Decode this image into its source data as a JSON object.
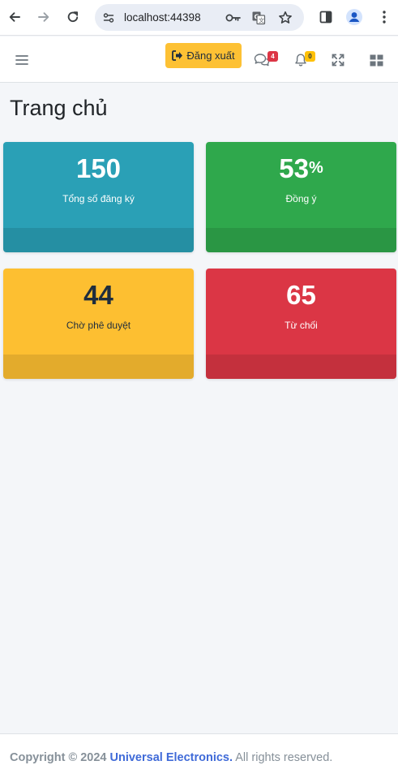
{
  "browser": {
    "url": "localhost:44398",
    "icons": [
      "back-arrow-icon",
      "forward-arrow-icon",
      "reload-icon",
      "site-settings-icon",
      "password-key-icon",
      "translate-icon",
      "bookmark-star-icon",
      "side-panel-icon",
      "profile-avatar-icon",
      "more-menu-icon"
    ]
  },
  "navbar": {
    "logout_label": "Đăng xuất",
    "messages_count": "4",
    "notifications_count": "0",
    "colors": {
      "logout_bg": "#fdc134",
      "messages_badge": "#dc3545",
      "notifications_badge": "#ffc107"
    }
  },
  "page": {
    "title": "Trang chủ"
  },
  "stats": [
    {
      "value": "150",
      "suffix": "",
      "label": "Tổng số đăng ký",
      "color": "#2aa0b6"
    },
    {
      "value": "53",
      "suffix": "%",
      "label": "Đồng ý",
      "color": "#2fa84c"
    },
    {
      "value": "44",
      "suffix": "",
      "label": "Chờ phê duyệt",
      "color": "#fdbf31"
    },
    {
      "value": "65",
      "suffix": "",
      "label": "Từ chối",
      "color": "#db3645"
    }
  ],
  "footer": {
    "prefix": "Copyright © 2024",
    "brand": "Universal Electronics.",
    "suffix": "All rights reserved."
  }
}
